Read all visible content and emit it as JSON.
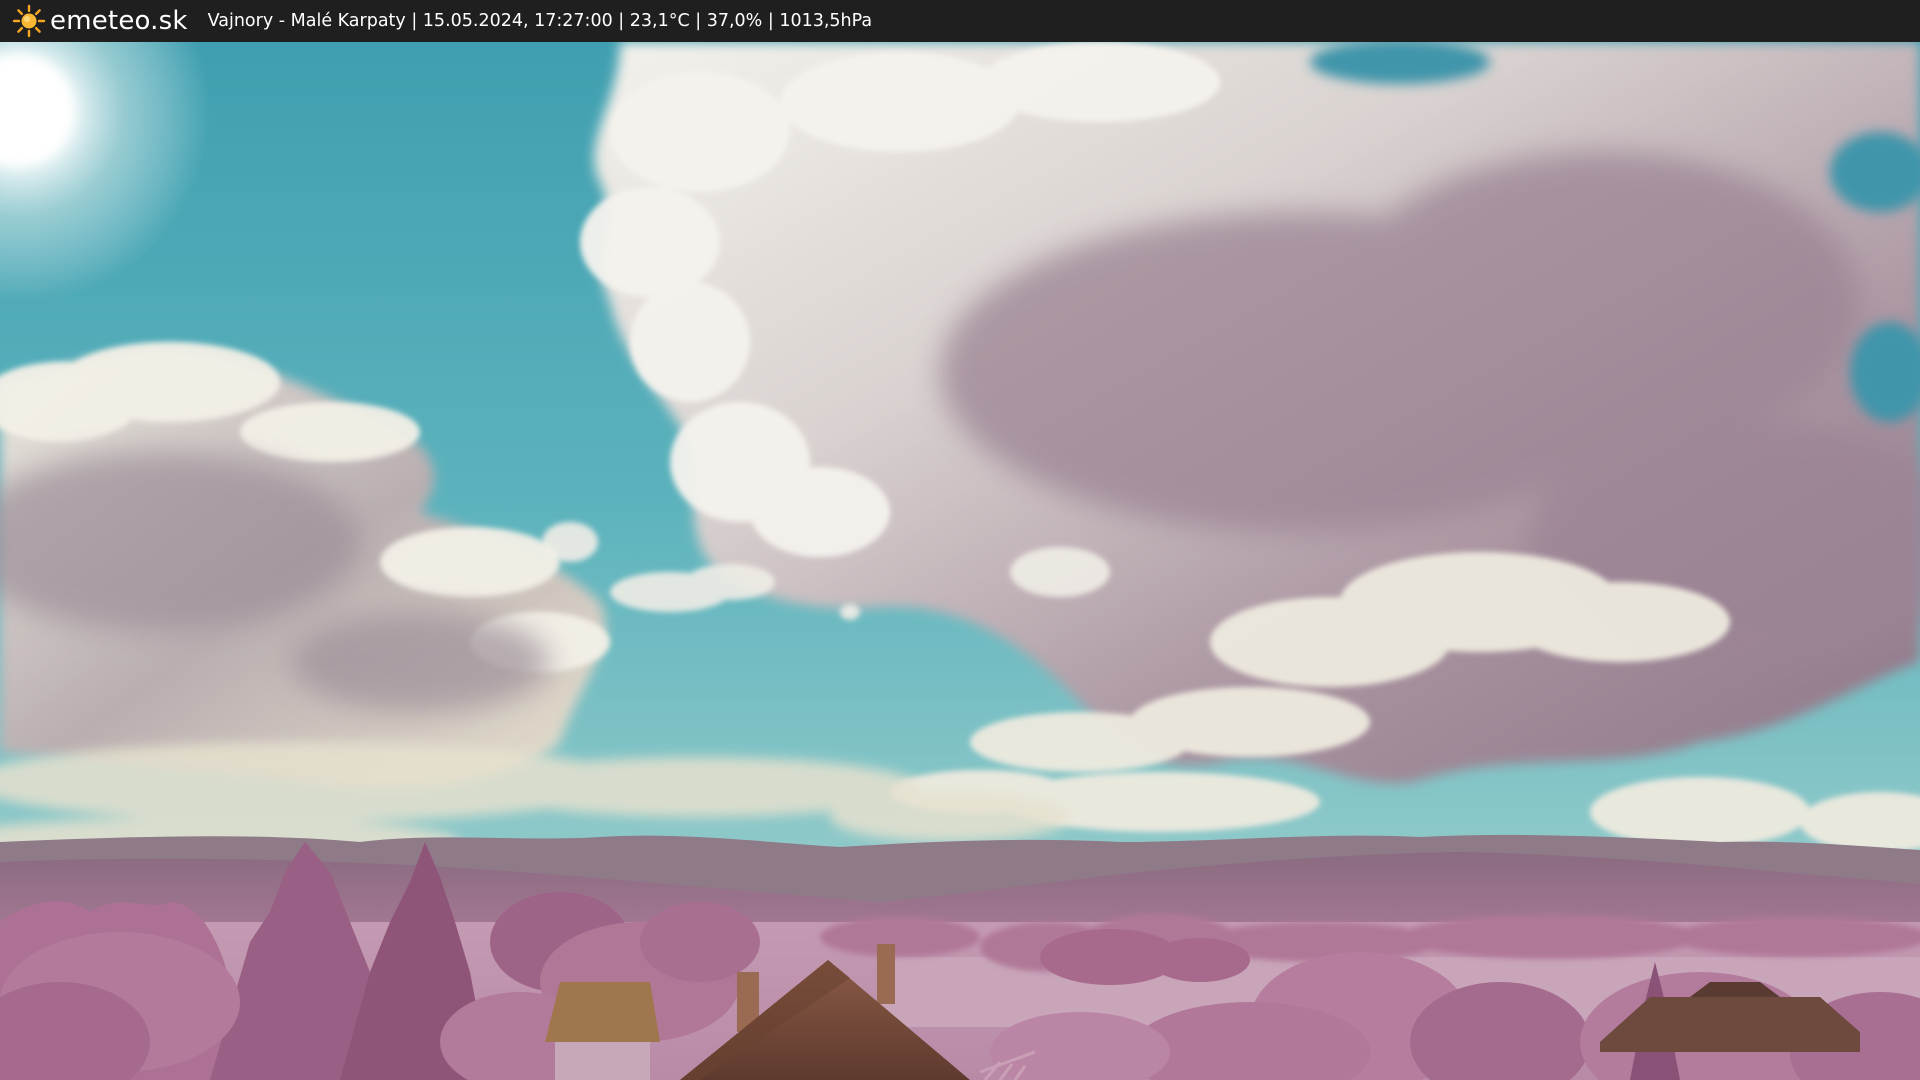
{
  "header": {
    "brand": "emeteo.sk",
    "logo_icon": "sun-icon",
    "info": "Vajnory - Malé Karpaty | 15.05.2024, 17:27:00 | 23,1°C | 37,0% | 1013,5hPa"
  },
  "scene": {
    "description_icon": "webcam-landscape-image",
    "colors": {
      "sky_top": "#4aa7b4",
      "sky_low": "#8cc5c8",
      "cloud_light": "#f2efe8",
      "cloud_shadow": "#9d8a99",
      "foliage": "#b77da1",
      "hills": "#8e6a81",
      "roof": "#7a4c3c",
      "topbar": "#1f1f1f"
    }
  }
}
